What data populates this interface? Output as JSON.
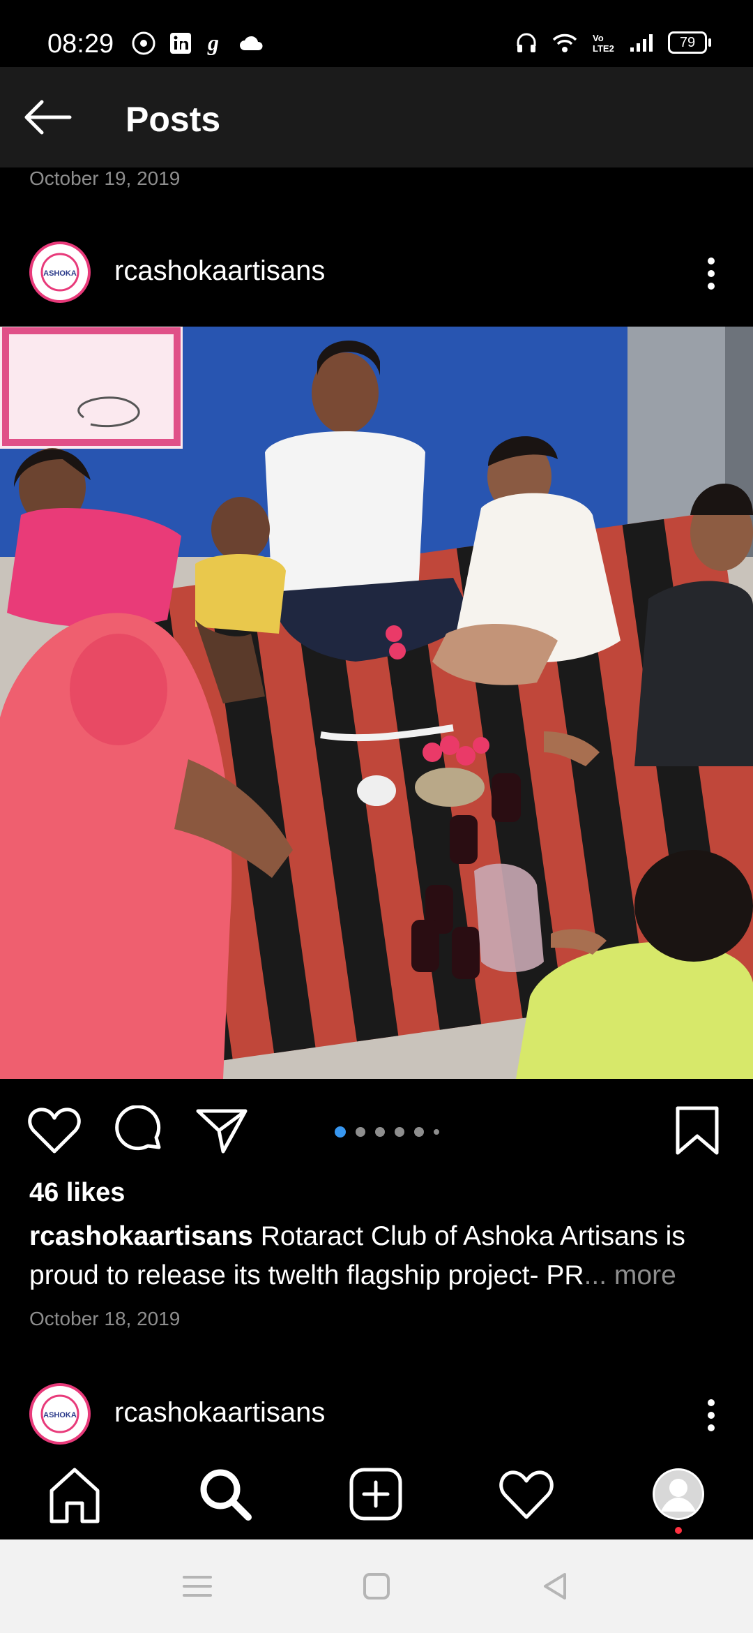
{
  "status_bar": {
    "time": "08:29",
    "battery": "79",
    "left_icons": [
      "music-icon",
      "linkedin-icon",
      "grammarly-icon",
      "cloud-icon"
    ],
    "right_icons": [
      "headphones-icon",
      "wifi-icon",
      "volte-icon",
      "signal-icon",
      "battery-icon"
    ]
  },
  "topbar": {
    "title": "Posts"
  },
  "previous_post": {
    "date": "October 19, 2019"
  },
  "post": {
    "username": "rcashokaartisans",
    "avatar_text": "ASHOKA",
    "likes": "46 likes",
    "caption_user": "rcashokaartisans",
    "caption_text": "Rotaract Club of Ashoka Artisans is proud to release its twelth flagship project- PR",
    "caption_more": "... more",
    "date": "October 18, 2019",
    "carousel": {
      "count": 6,
      "active_index": 0
    }
  },
  "next_post": {
    "username": "rcashokaartisans",
    "avatar_text": "ASHOKA"
  },
  "bottom_nav": {
    "items": [
      "home-icon",
      "search-icon",
      "new-post-icon",
      "activity-heart-icon",
      "profile-icon"
    ]
  },
  "colors": {
    "background": "#000000",
    "topbar": "#1b1b1b",
    "secondary_text": "#8e8e8e",
    "accent": "#3897f0",
    "notification": "#ff3040"
  }
}
